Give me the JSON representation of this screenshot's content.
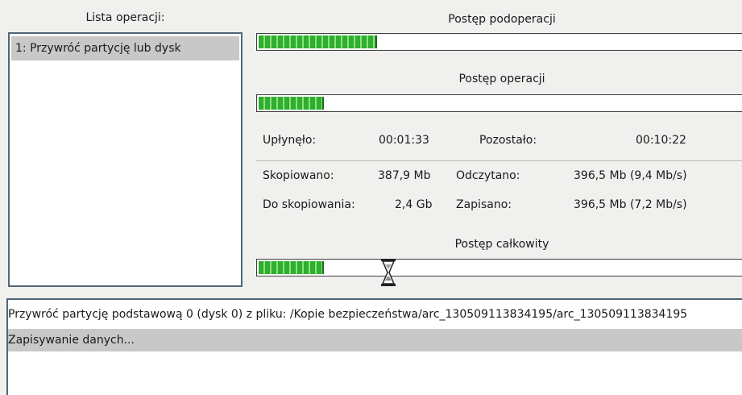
{
  "operations": {
    "header": "Lista operacji:",
    "items": [
      {
        "label": "1: Przywróć partycję lub dysk"
      }
    ]
  },
  "progress": {
    "sub": {
      "label": "Postęp podoperacji",
      "fraction": 0.24
    },
    "op": {
      "label": "Postęp operacji",
      "fraction": 0.13
    },
    "total": {
      "label": "Postęp całkowity",
      "fraction": 0.13
    }
  },
  "time": {
    "elapsed_label": "Upłynęło:",
    "elapsed_value": "00:01:33",
    "remaining_label": "Pozostało:",
    "remaining_value": "00:10:22"
  },
  "stats": {
    "copied_label": "Skopiowano:",
    "copied_value": "387,9 Mb",
    "read_label": "Odczytano:",
    "read_value": "396,5 Mb (9,4 Mb/s)",
    "tocopy_label": "Do skopiowania:",
    "tocopy_value": "2,4 Gb",
    "written_label": "Zapisano:",
    "written_value": "396,5 Mb (7,2 Mb/s)"
  },
  "log": {
    "line1": "Przywróć partycję podstawową 0 (dysk 0) z pliku: /Kopie bezpieczeństwa/arc_130509113834195/arc_130509113834195",
    "line2": "Zapisywanie danych..."
  },
  "icons": {
    "cursor": "hourglass-icon"
  },
  "colors": {
    "progress_green": "#2fae2f",
    "selection_gray": "#c8c8c8",
    "border": "#4f6678"
  }
}
